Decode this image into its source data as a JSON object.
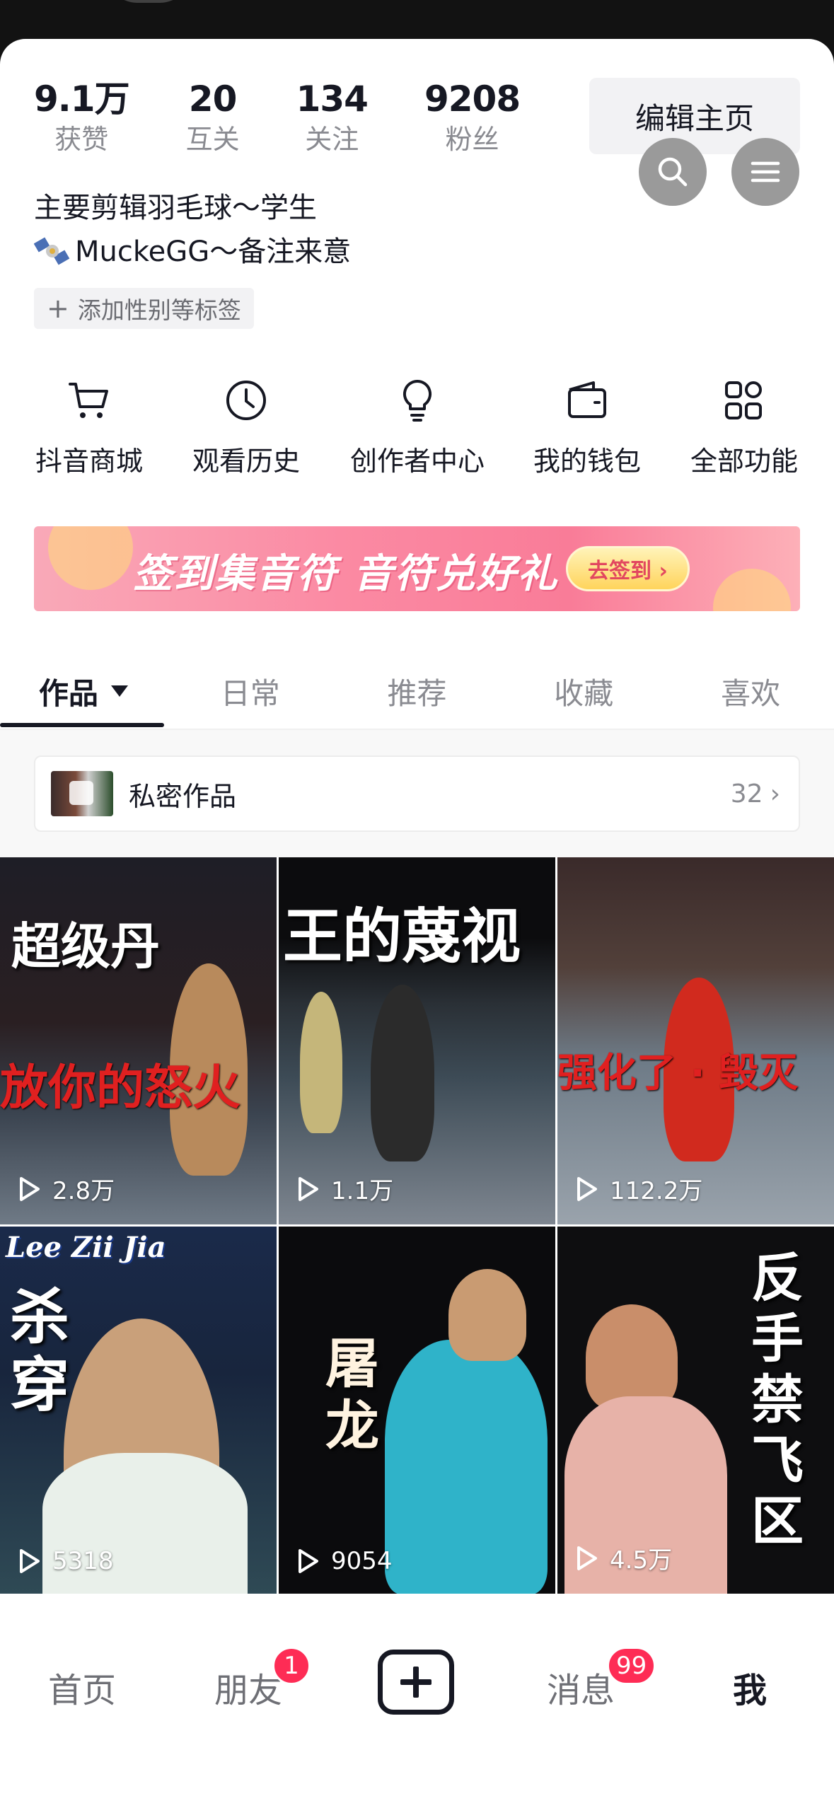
{
  "stats": [
    {
      "value": "9.1万",
      "label": "获赞"
    },
    {
      "value": "20",
      "label": "互关"
    },
    {
      "value": "134",
      "label": "关注"
    },
    {
      "value": "9208",
      "label": "粉丝"
    }
  ],
  "edit_profile_label": "编辑主页",
  "bio": {
    "line1": "主要剪辑羽毛球～学生",
    "line2": "MuckeGG～备注来意"
  },
  "add_tag_label": "添加性别等标签",
  "features": [
    {
      "label": "抖音商城",
      "icon": "cart-icon"
    },
    {
      "label": "观看历史",
      "icon": "clock-icon"
    },
    {
      "label": "创作者中心",
      "icon": "bulb-icon"
    },
    {
      "label": "我的钱包",
      "icon": "wallet-icon"
    },
    {
      "label": "全部功能",
      "icon": "grid-icon"
    }
  ],
  "banner": {
    "text": "签到集音符 音符兑好礼",
    "button": "去签到 ›"
  },
  "tabs": [
    {
      "label": "作品",
      "active": true
    },
    {
      "label": "日常"
    },
    {
      "label": "推荐"
    },
    {
      "label": "收藏"
    },
    {
      "label": "喜欢"
    }
  ],
  "private_works": {
    "label": "私密作品",
    "count": "32",
    "chevron": "›"
  },
  "videos": [
    {
      "title": "超级丹",
      "overlay": "放你的怒火",
      "views": "2.8万"
    },
    {
      "title": "王的蔑视",
      "views": "1.1万"
    },
    {
      "overlay": "强化了 · 毁灭",
      "views": "112.2万"
    },
    {
      "tag": "Lee Zii Jia",
      "title": "杀穿",
      "views": "5318"
    },
    {
      "title": "屠龙",
      "views": "9054"
    },
    {
      "title": "反手禁飞区",
      "views": "4.5万"
    }
  ],
  "bottom_nav": {
    "home": "首页",
    "friends": "朋友",
    "friends_badge": "1",
    "messages": "消息",
    "messages_badge": "99",
    "me": "我"
  },
  "colors": {
    "accent": "#fe2c55",
    "text": "#161823",
    "muted": "#8a8b91"
  }
}
